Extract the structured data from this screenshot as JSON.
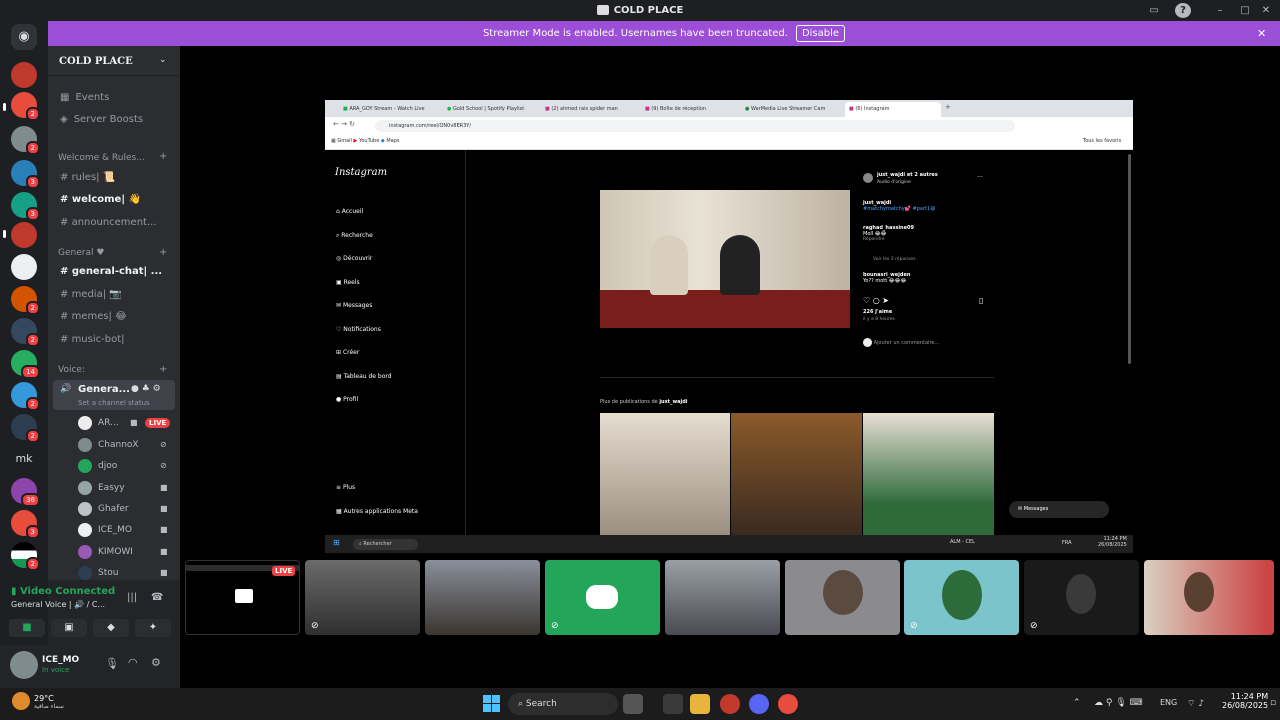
{
  "window": {
    "title": "COLD PLACE",
    "help": "?"
  },
  "banner": {
    "text": "Streamer Mode is enabled. Usernames have been truncated.",
    "button": "Disable"
  },
  "rail": {
    "mk": "mk",
    "badges": [
      "2",
      "2",
      "3",
      "3",
      "2",
      "2",
      "3",
      "14",
      "2",
      "2",
      "36",
      "3",
      "2"
    ]
  },
  "server": {
    "name": "COLD PLACE",
    "top_items": [
      "Events",
      "Server Boosts"
    ],
    "cat1": "Welcome & Rules...",
    "channels1": [
      "rules| 📜",
      "welcome| 👋",
      "announcement..."
    ],
    "cat2": "General ♥",
    "channels2": [
      "general-chat| ...",
      "media| 📷",
      "memes| 😂",
      "music-bot|"
    ],
    "cat3": "Voice:",
    "voice_channel": "Genera...",
    "voice_status": "Set a channel status",
    "voice_users": [
      "AR...",
      "ChannoX",
      "djoo",
      "Easyy",
      "Ghafer",
      "ICE_MO",
      "KIMOWI",
      "Stou"
    ],
    "live": "LIVE"
  },
  "voice_panel": {
    "status": "Video Connected",
    "channel": "General Voice | 🔊 / C..."
  },
  "me": {
    "name": "ICE_MO",
    "status": "In voice"
  },
  "browser": {
    "tabs": [
      "ARA_GOY Stream - Watch Live",
      "Gold School | Spotify Playlist",
      "(2) ahmed rais spider man",
      "(9) Boîte de réception",
      "WarMedia Live Streamer Cam",
      "(6) Instagram"
    ],
    "url": "instagram.com/reel/ON0v8ER3Y/",
    "bookmarks": [
      "Gmail",
      "YouTube",
      "Maps"
    ],
    "bookmarks_right": "Tous les favoris"
  },
  "instagram": {
    "logo": "Instagram",
    "nav": [
      "Accueil",
      "Recherche",
      "Découvrir",
      "Reels",
      "Messages",
      "Notifications",
      "Créer",
      "Tableau de bord",
      "Profil"
    ],
    "more": [
      "Plus",
      "Autres applications Meta"
    ],
    "post_header": "just_wajdi et 2 autres",
    "post_audio": "Audio d'origine",
    "comments": [
      {
        "user": "just_wajdi",
        "text": "#matchymatchy💕 #part1😄"
      },
      {
        "user": "raghad_hassine09",
        "text": "Moll 😂😂"
      },
      {
        "user": "bounasri_wejden",
        "text": "Yo?? mott 😂😂😂"
      }
    ],
    "view_replies": "Voir les 3 réponses",
    "reply": "Répondre",
    "likes": "226 J'aime",
    "time": "il y a 8 heures",
    "comment_placeholder": "Ajouter un commentaire...",
    "more_from": "Plus de publications de",
    "more_user": "just_wajdi",
    "messages": "Messages"
  },
  "inner_taskbar": {
    "search": "Rechercher",
    "weather": "ALM - CEL",
    "time": "11:24 PM",
    "date": "26/08/2025",
    "lang": "FRA"
  },
  "tiles": {
    "live": "LIVE"
  },
  "taskbar": {
    "temp": "29°C",
    "weather_desc": "سماء صافية",
    "search": "Search",
    "lang": "ENG",
    "time": "11:24 PM",
    "date": "26/08/2025"
  },
  "colors": {
    "banner": "#9b4ed6",
    "live": "#ed4245",
    "discord": "#23a55a",
    "accent": "#5865f2"
  }
}
